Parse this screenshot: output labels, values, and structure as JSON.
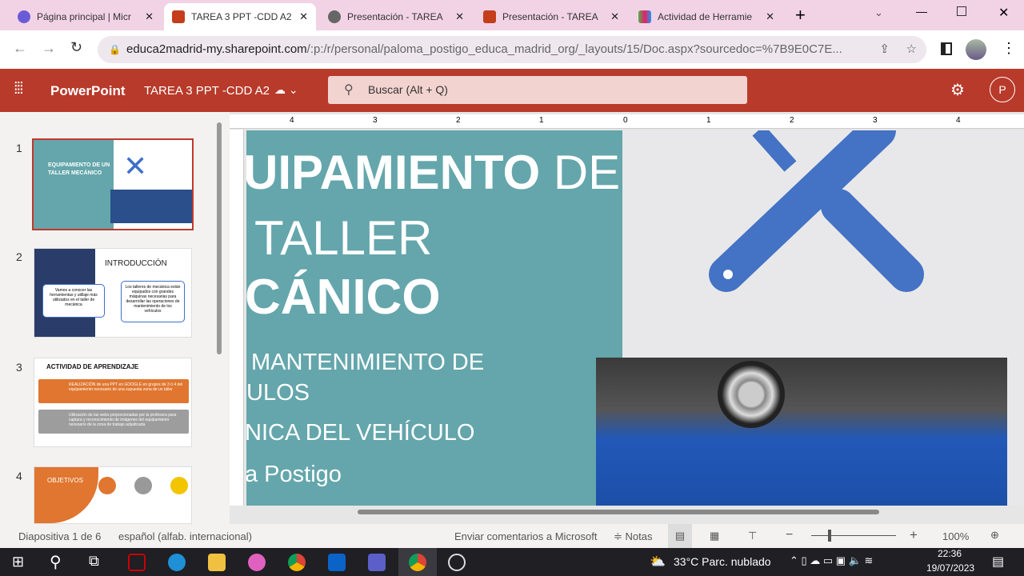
{
  "browser": {
    "tabs": [
      {
        "title": "Página principal | Micr",
        "color": "#6b5bd6"
      },
      {
        "title": "TAREA 3 PPT -CDD A2",
        "color": "#c43e1c"
      },
      {
        "title": "Presentación - TAREA",
        "color": "#555"
      },
      {
        "title": "Presentación - TAREA",
        "color": "#c43e1c"
      },
      {
        "title": "Actividad de Herramie",
        "color": "#4caf50"
      }
    ],
    "new_tab": "+",
    "url_host": "educa2madrid-my.sharepoint.com",
    "url_path": "/:p:/r/personal/paloma_postigo_educa_madrid_org/_layouts/15/Doc.aspx?sourcedoc=%7B9E0C7E..."
  },
  "app": {
    "name": "PowerPoint",
    "doc_title": "TAREA 3 PPT -CDD A2",
    "search_placeholder": "Buscar (Alt + Q)",
    "avatar": "P",
    "accent": "#b83a2a"
  },
  "thumbnails": [
    {
      "num": "1",
      "title": "EQUIPAMIENTO DE UN TALLER MECÁNICO"
    },
    {
      "num": "2",
      "title": "INTRODUCCIÓN",
      "box1": "Vamos a conocer las herramientas y utillaje más utilizados en el taller de mecánica",
      "box2": "Los talleres de mecánica están equipados con grandes máquinas necesarias para desarrollar las operaciones de mantenimiento de los vehículos"
    },
    {
      "num": "3",
      "title": "ACTIVIDAD DE APRENDIZAJE",
      "item1": "REALIZACIÓN de una PPT en GOOGLE en grupos de 3 ó 4 del equipamiento necesario de una supuesta zona de un taller",
      "item2": "Utilización de las webs proporcionadas por la profesora para captura y reconocimiento de imágenes del equipamiento necesario de la zona de trabajo adjudicada"
    },
    {
      "num": "4",
      "title": "OBJETIVOS"
    }
  ],
  "ruler": [
    "4",
    "3",
    "2",
    "1",
    "0",
    "1",
    "2",
    "3",
    "4"
  ],
  "slide": {
    "line1_bold": "UIPAMIENTO",
    "line1_light": " DE",
    "line2": "TALLER",
    "line3": "CÁNICO",
    "sub1": "MANTENIMIENTO DE",
    "sub2": "ULOS",
    "sub3": "NICA DEL VEHÍCULO",
    "author": "a Postigo"
  },
  "status": {
    "slide": "Diapositiva 1 de 6",
    "lang": "español (alfab. internacional)",
    "feedback": "Enviar comentarios a Microsoft",
    "notes": "Notas",
    "zoom": "100%",
    "zoom_value": 100
  },
  "taskbar": {
    "weather": "33°C  Parc. nublado",
    "time": "22:36",
    "date": "19/07/2023"
  }
}
